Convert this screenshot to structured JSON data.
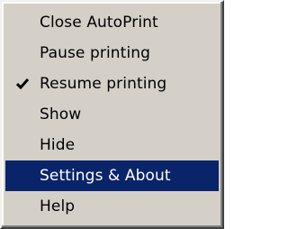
{
  "menu": {
    "items": [
      {
        "label": "Close AutoPrint",
        "checked": false,
        "highlighted": false
      },
      {
        "label": "Pause printing",
        "checked": false,
        "highlighted": false
      },
      {
        "label": "Resume printing",
        "checked": true,
        "highlighted": false,
        "icon": "checkmark-icon"
      },
      {
        "label": "Show",
        "checked": false,
        "highlighted": false
      },
      {
        "label": "Hide",
        "checked": false,
        "highlighted": false
      },
      {
        "label": "Settings & About",
        "checked": false,
        "highlighted": true
      },
      {
        "label": "Help",
        "checked": false,
        "highlighted": false
      }
    ],
    "colors": {
      "background": "#d4d0c8",
      "highlight": "#0a246a",
      "highlight_text": "#ffffff",
      "text": "#000000"
    }
  }
}
